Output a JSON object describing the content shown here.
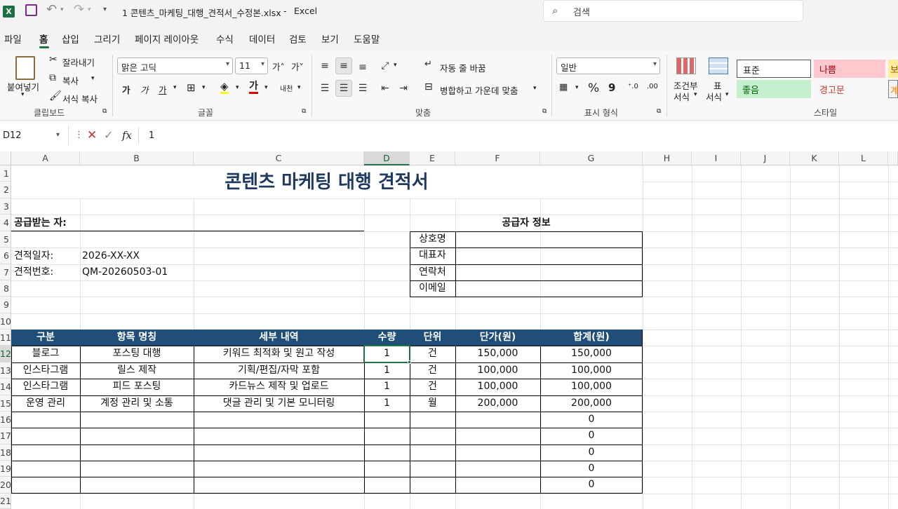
{
  "titlebar": {
    "file_title": "1 콘텐츠_마케팅_대행_견적서_수정본.xlsx",
    "sep": "-",
    "app_name": "Excel",
    "search_placeholder": "검색"
  },
  "menu": [
    "파일",
    "홈",
    "삽입",
    "그리기",
    "페이지 레이아웃",
    "수식",
    "데이터",
    "검토",
    "보기",
    "도움말"
  ],
  "ribbon": {
    "clipboard": {
      "paste": "붙여넣기",
      "cut": "잘라내기",
      "copy": "복사",
      "format_painter": "서식 복사",
      "label": "클립보드"
    },
    "font": {
      "name": "맑은 고딕",
      "size": "11",
      "grow": "가˄",
      "shrink": "가˅",
      "bold": "가",
      "italic": "가",
      "underline": "가",
      "phonetic": "내천",
      "label": "글꼴"
    },
    "alignment": {
      "wrap": "자동 줄 바꿈",
      "merge": "병합하고 가운데 맞춤",
      "label": "맞춤"
    },
    "number": {
      "format": "일반",
      "percent": "%",
      "comma": "9",
      "label": "표시 형식"
    },
    "styles": {
      "conditional": "조건부",
      "conditional2": "서식",
      "table": "표",
      "table2": "서식",
      "normal": "표준",
      "bad": "나쁨",
      "good": "좋음",
      "warning": "경고문",
      "label": "스타일",
      "bad_partial": "보",
      "warn_partial": "계"
    }
  },
  "formula_bar": {
    "name_box": "D12",
    "value": "1",
    "fx": "fx"
  },
  "columns": [
    "A",
    "B",
    "C",
    "D",
    "E",
    "F",
    "G",
    "H",
    "I",
    "J",
    "K",
    "L"
  ],
  "rows": [
    "1",
    "2",
    "3",
    "4",
    "5",
    "6",
    "7",
    "8",
    "9",
    "10",
    "11",
    "12",
    "13",
    "14",
    "15",
    "16",
    "17",
    "18",
    "19",
    "20",
    "21"
  ],
  "sheet": {
    "title": "콘텐츠 마케팅 대행 견적서",
    "recipient_label": "공급받는 자:",
    "supplier_header": "공급자 정보",
    "supplier_fields": [
      "상호명",
      "대표자",
      "연락처",
      "이메일"
    ],
    "date_label": "견적일자:",
    "date_value": "2026-XX-XX",
    "number_label": "견적번호:",
    "number_value": "QM-20260503-01",
    "table_headers": [
      "구분",
      "항목 명칭",
      "세부 내역",
      "수량",
      "단위",
      "단가(원)",
      "합계(원)"
    ],
    "table_rows": [
      [
        "블로그",
        "포스팅 대행",
        "키워드 최적화 및 원고 작성",
        "1",
        "건",
        "150,000",
        "150,000"
      ],
      [
        "인스타그램",
        "릴스 제작",
        "기획/편집/자막 포함",
        "1",
        "건",
        "100,000",
        "100,000"
      ],
      [
        "인스타그램",
        "피드 포스팅",
        "카드뉴스 제작 및 업로드",
        "1",
        "건",
        "100,000",
        "100,000"
      ],
      [
        "운영 관리",
        "계정 관리 및 소통",
        "댓글 관리 및 기본 모니터링",
        "1",
        "월",
        "200,000",
        "200,000"
      ],
      [
        "",
        "",
        "",
        "",
        "",
        "",
        "0"
      ],
      [
        "",
        "",
        "",
        "",
        "",
        "",
        "0"
      ],
      [
        "",
        "",
        "",
        "",
        "",
        "",
        "0"
      ],
      [
        "",
        "",
        "",
        "",
        "",
        "",
        "0"
      ],
      [
        "",
        "",
        "",
        "",
        "",
        "",
        "0"
      ]
    ]
  },
  "colors": {
    "header_band": "#1f4e79",
    "title_text": "#1f3a5f",
    "excel_green": "#217346",
    "bad_bg": "#ffc7ce",
    "good_bg": "#c6efce",
    "bad_text": "#9c0006",
    "warning_text": "#c0392b"
  }
}
